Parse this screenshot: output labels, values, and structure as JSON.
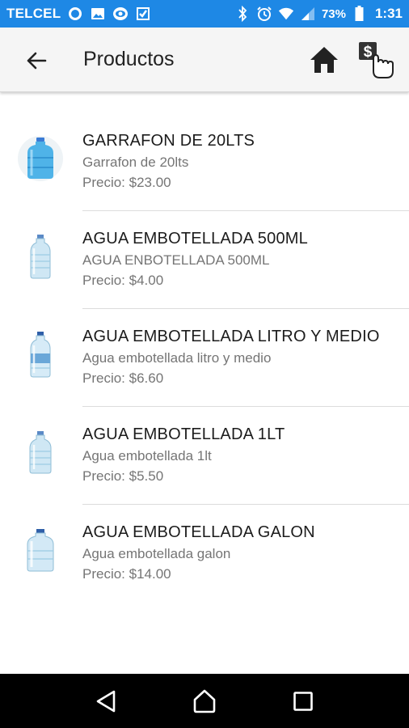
{
  "status_bar": {
    "carrier": "TELCEL",
    "battery": "73%",
    "time": "1:31",
    "icons_left": [
      "whatsapp-icon",
      "gallery-icon",
      "cbs-icon",
      "check-app-icon"
    ],
    "icons_right": [
      "bluetooth-icon",
      "alarm-icon",
      "wifi-icon",
      "signal-icon",
      "battery-icon"
    ]
  },
  "app_bar": {
    "title": "Productos",
    "back_icon": "arrow-back-icon",
    "home_icon": "home-icon",
    "pay_icon": "dollar-hand-icon"
  },
  "products": [
    {
      "name": "GARRAFON DE 20LTS",
      "description": "Garrafon de 20lts",
      "price": "Precio: $23.00",
      "image": "water-jug-icon"
    },
    {
      "name": "AGUA EMBOTELLADA 500ML",
      "description": "AGUA ENBOTELLADA 500ML",
      "price": "Precio: $4.00",
      "image": "water-bottle-icon"
    },
    {
      "name": "AGUA EMBOTELLADA LITRO Y MEDIO",
      "description": "Agua embotellada litro y medio",
      "price": "Precio: $6.60",
      "image": "water-bottle-icon"
    },
    {
      "name": "AGUA EMBOTELLADA 1LT",
      "description": "Agua embotellada 1lt",
      "price": "Precio: $5.50",
      "image": "water-bottle-icon"
    },
    {
      "name": "AGUA EMBOTELLADA GALON",
      "description": "Agua embotellada galon",
      "price": "Precio: $14.00",
      "image": "water-gallon-icon"
    }
  ],
  "nav_bar": {
    "icons": [
      "back-triangle-icon",
      "home-outline-icon",
      "recents-square-icon"
    ]
  },
  "colors": {
    "status_bar": "#1e88e5",
    "app_bar": "#f5f5f5",
    "text_primary": "#1c1c1c",
    "text_secondary": "#757575"
  }
}
